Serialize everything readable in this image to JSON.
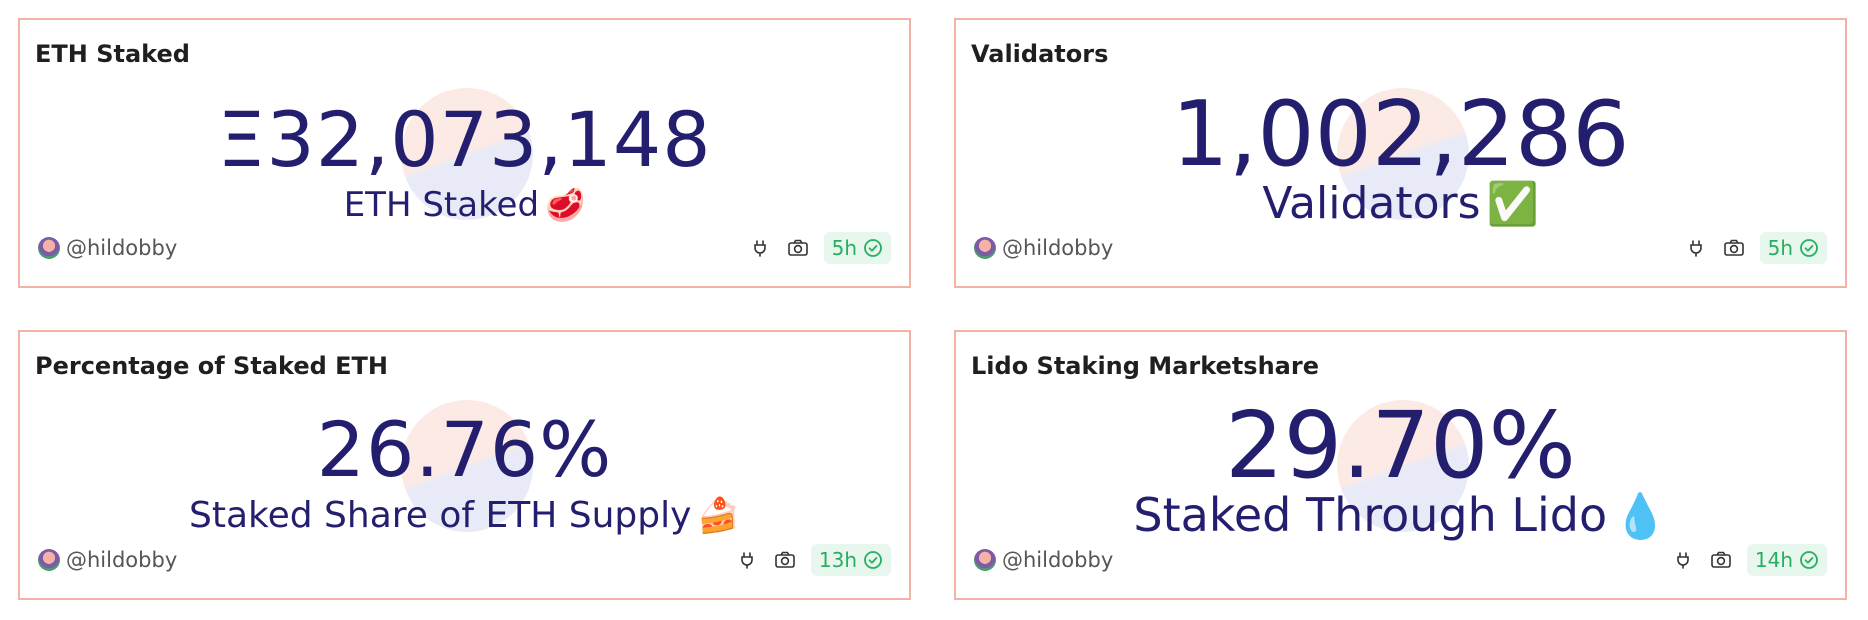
{
  "cards": [
    {
      "title": "ETH Staked",
      "value": "Ξ32,073,148",
      "subtitle": "ETH Staked",
      "subtitle_emoji": "🥩",
      "author": "@hildobby",
      "age": "5h"
    },
    {
      "title": "Validators",
      "value": "1,002,286",
      "subtitle": "Validators",
      "subtitle_emoji": "✅",
      "author": "@hildobby",
      "age": "5h"
    },
    {
      "title": "Percentage of Staked ETH",
      "value": "26.76%",
      "subtitle": "Staked Share of ETH Supply",
      "subtitle_emoji": "🍰",
      "author": "@hildobby",
      "age": "13h"
    },
    {
      "title": "Lido Staking Marketshare",
      "value": "29.70%",
      "subtitle": "Staked Through Lido",
      "subtitle_emoji": "💧",
      "author": "@hildobby",
      "age": "14h"
    }
  ],
  "colors": {
    "border": "#f2b3a6",
    "value": "#231f6e",
    "badge_bg": "#e8f7ee",
    "badge_fg": "#27ae60"
  },
  "icons": [
    "plug-icon",
    "camera-icon",
    "check-circle-icon"
  ]
}
